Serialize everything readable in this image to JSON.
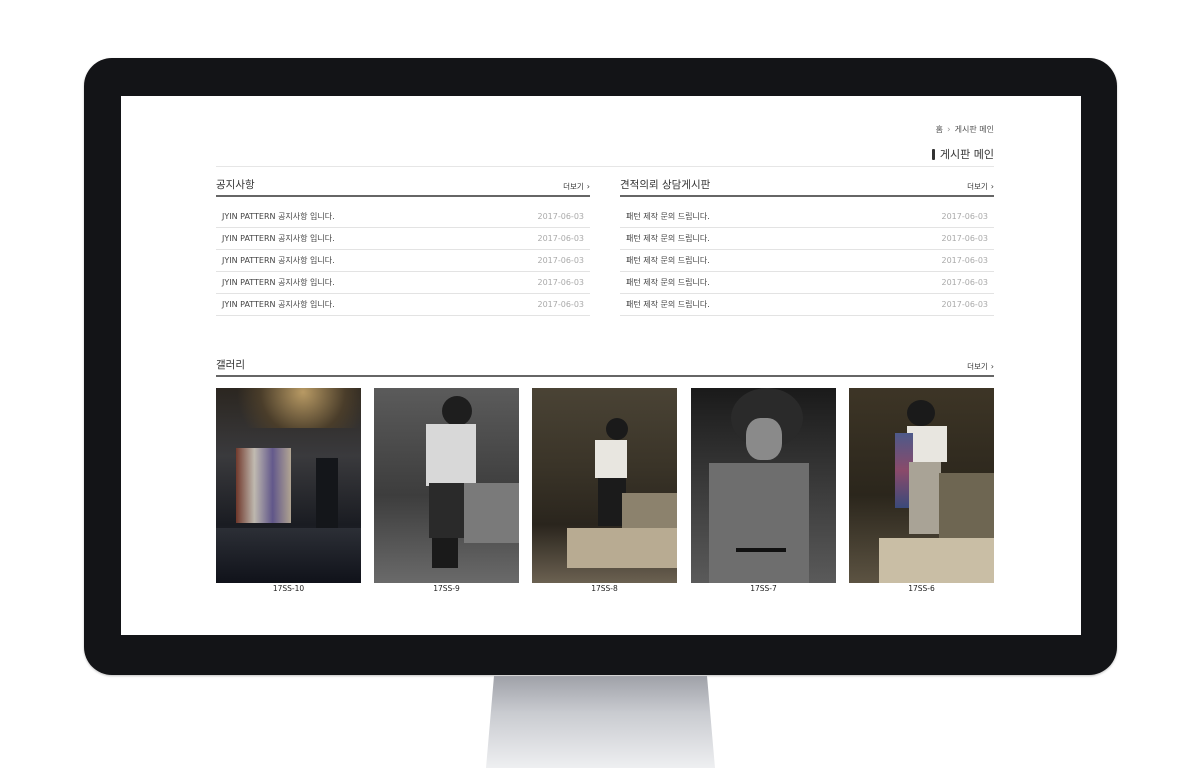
{
  "breadcrumb": {
    "home": "홈",
    "current": "게시판 메인"
  },
  "page_title": "게시판 메인",
  "notice_board": {
    "title": "공지사항",
    "more_label": "더보기",
    "rows": [
      {
        "subject": "JYIN PATTERN 공지사항 입니다.",
        "date": "2017-06-03"
      },
      {
        "subject": "JYIN PATTERN 공지사항 입니다.",
        "date": "2017-06-03"
      },
      {
        "subject": "JYIN PATTERN 공지사항 입니다.",
        "date": "2017-06-03"
      },
      {
        "subject": "JYIN PATTERN 공지사항 입니다.",
        "date": "2017-06-03"
      },
      {
        "subject": "JYIN PATTERN 공지사항 입니다.",
        "date": "2017-06-03"
      }
    ]
  },
  "inquiry_board": {
    "title": "견적의뢰 상담게시판",
    "more_label": "더보기",
    "rows": [
      {
        "subject": "패턴 제작 문의 드립니다.",
        "date": "2017-06-03"
      },
      {
        "subject": "패턴 제작 문의 드립니다.",
        "date": "2017-06-03"
      },
      {
        "subject": "패턴 제작 문의 드립니다.",
        "date": "2017-06-03"
      },
      {
        "subject": "패턴 제작 문의 드립니다.",
        "date": "2017-06-03"
      },
      {
        "subject": "패턴 제작 문의 드립니다.",
        "date": "2017-06-03"
      }
    ]
  },
  "gallery": {
    "title": "갤러리",
    "more_label": "더보기",
    "items": [
      {
        "caption": "17SS-10"
      },
      {
        "caption": "17SS-9"
      },
      {
        "caption": "17SS-8"
      },
      {
        "caption": "17SS-7"
      },
      {
        "caption": "17SS-6"
      }
    ]
  },
  "icons": {
    "breadcrumb_separator": "chevron-right-icon",
    "more_arrow": "chevron-right-icon"
  }
}
